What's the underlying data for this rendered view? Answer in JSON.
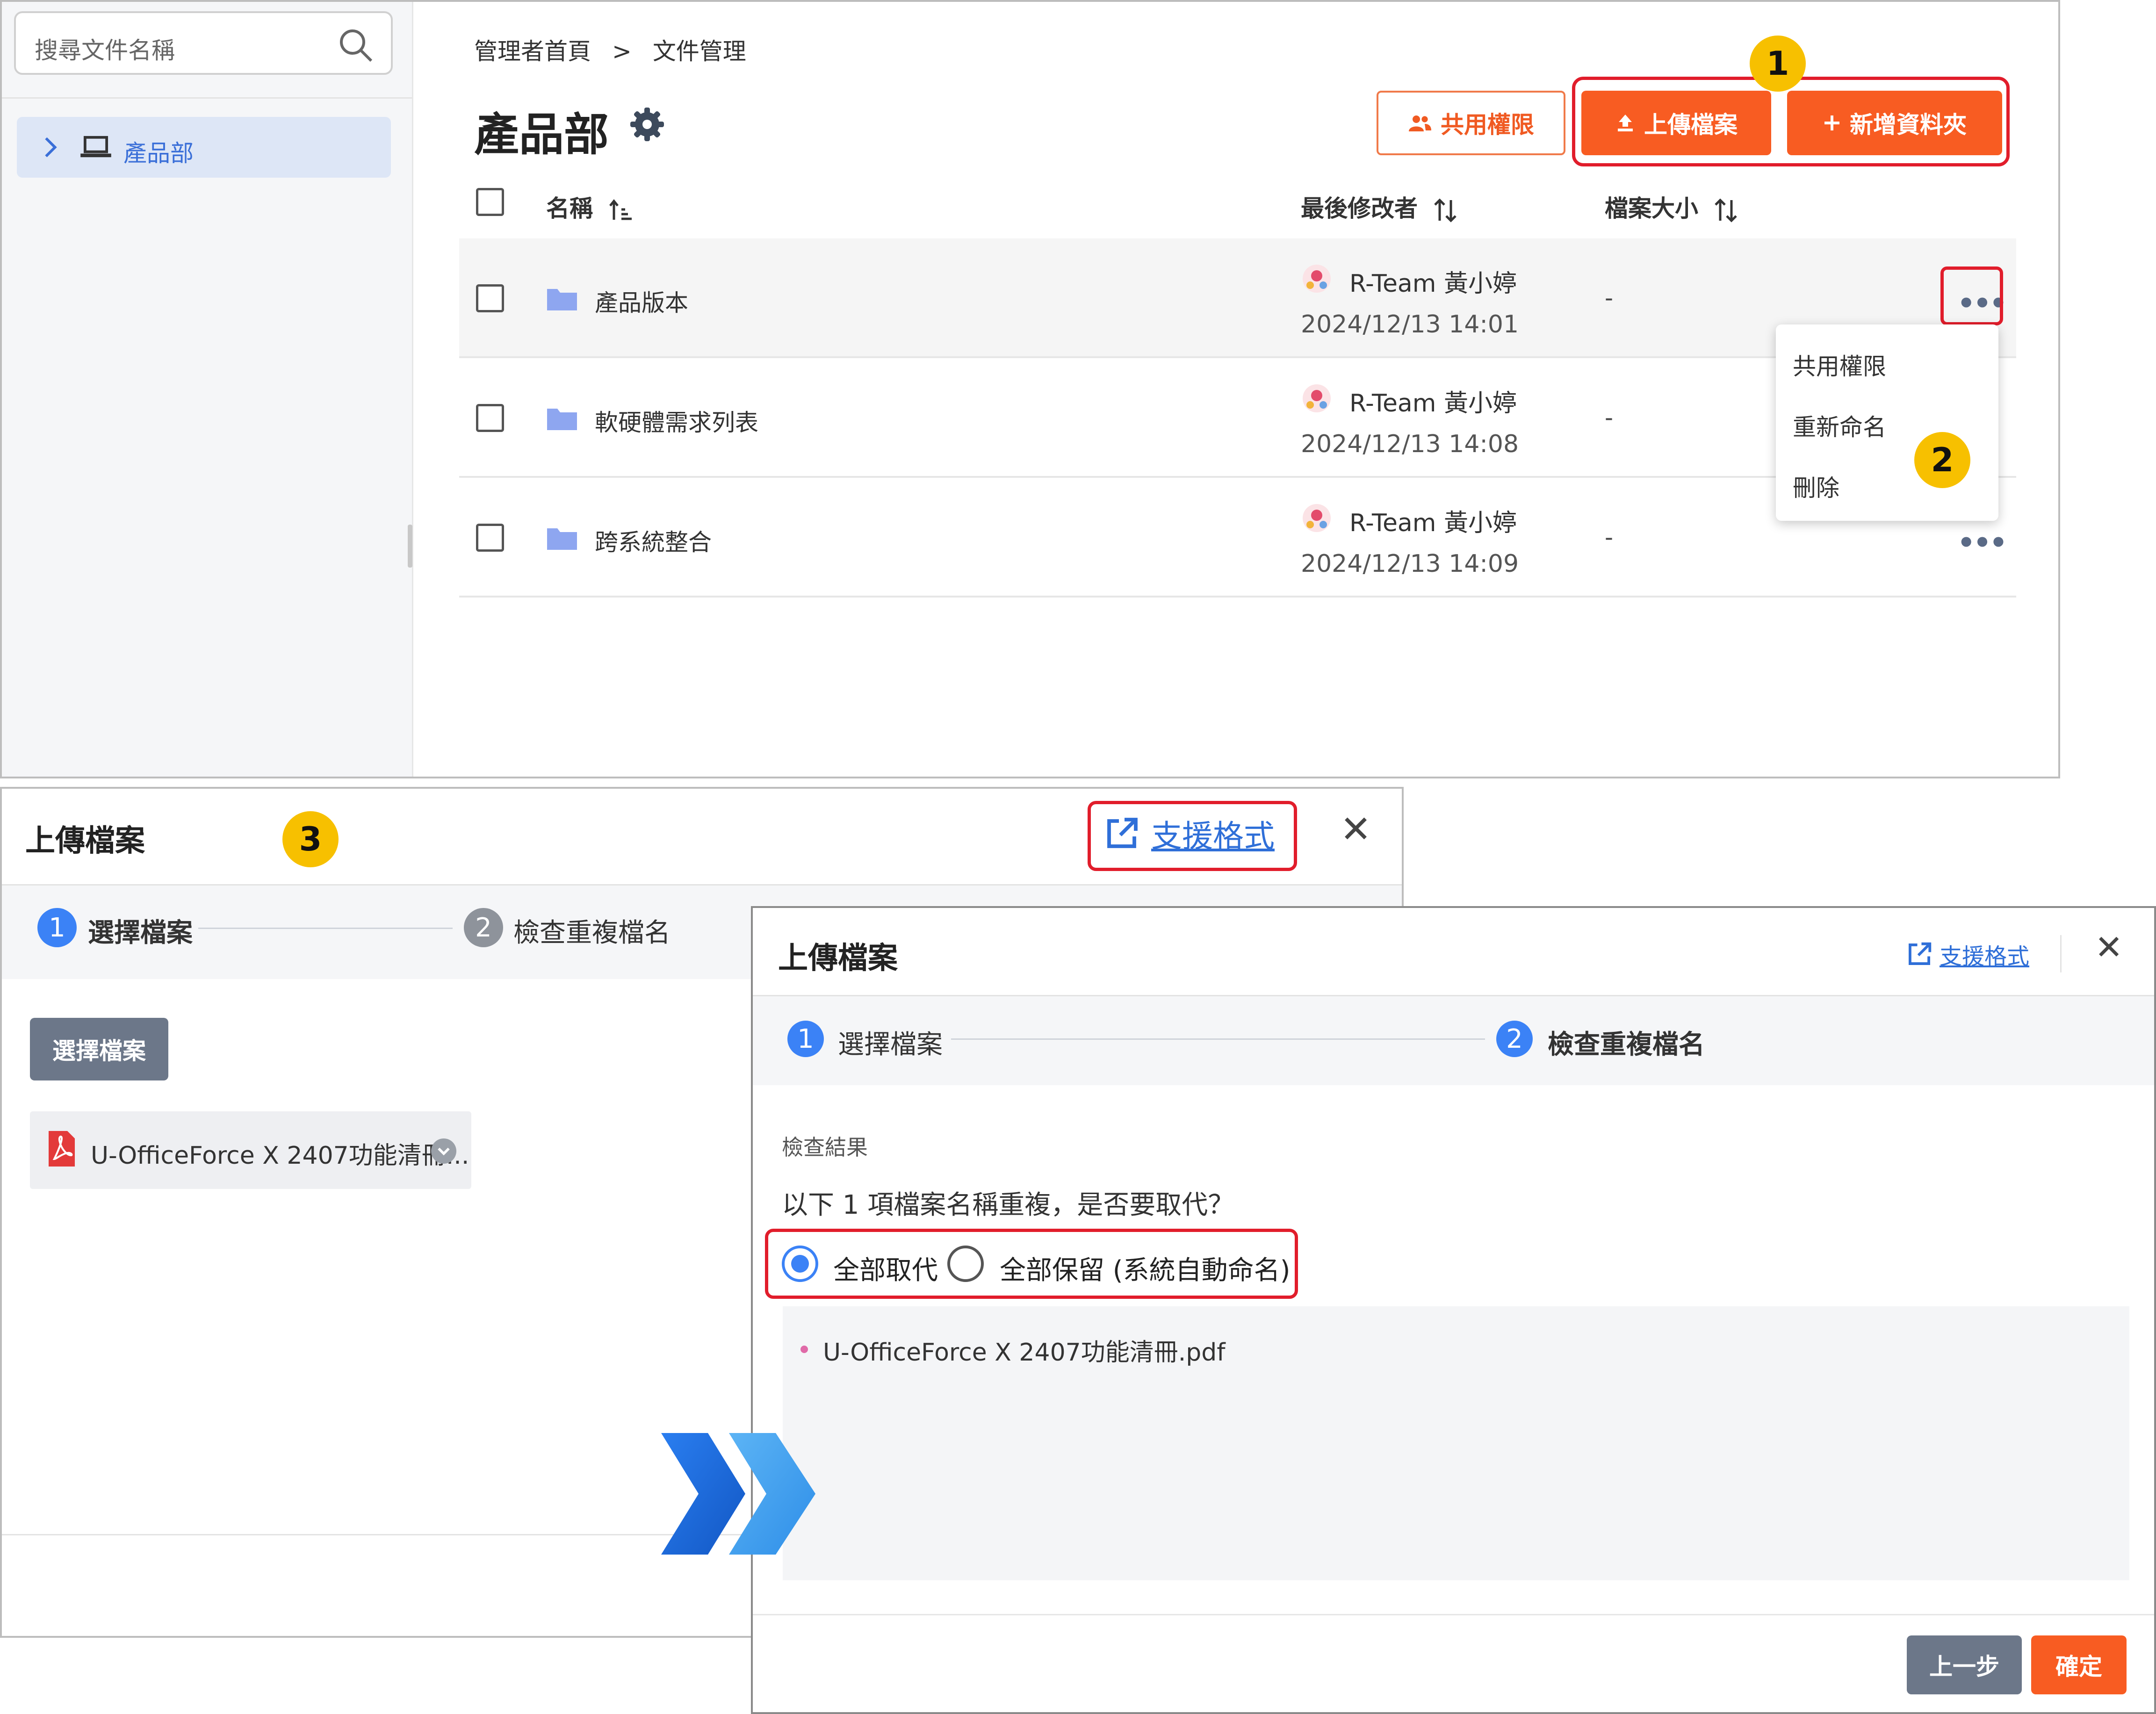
{
  "sidebar": {
    "search_placeholder": "搜尋文件名稱",
    "tree_item_label": "產品部"
  },
  "breadcrumb": {
    "home": "管理者首頁",
    "separator": ">",
    "current": "文件管理"
  },
  "page": {
    "title": "產品部"
  },
  "toolbar": {
    "share_label": "共用權限",
    "upload_label": "上傳檔案",
    "new_folder_label": "新增資料夾"
  },
  "table": {
    "headers": {
      "name": "名稱",
      "modifier": "最後修改者",
      "size": "檔案大小"
    },
    "rows": [
      {
        "name": "產品版本",
        "user": "R-Team 黃小婷",
        "date": "2024/12/13 14:01",
        "size": "-"
      },
      {
        "name": "軟硬體需求列表",
        "user": "R-Team 黃小婷",
        "date": "2024/12/13 14:08",
        "size": "-"
      },
      {
        "name": "跨系統整合",
        "user": "R-Team 黃小婷",
        "date": "2024/12/13 14:09",
        "size": "-"
      }
    ],
    "more_label": "•••"
  },
  "context_menu": {
    "items": [
      "共用權限",
      "重新命名",
      "刪除"
    ]
  },
  "badges": {
    "one": "1",
    "two": "2",
    "three": "3"
  },
  "dialog1": {
    "title": "上傳檔案",
    "support_link": "支援格式",
    "close": "✕",
    "steps": [
      {
        "num": "1",
        "label": "選擇檔案"
      },
      {
        "num": "2",
        "label": "檢查重複檔名"
      }
    ],
    "choose_button": "選擇檔案",
    "file_name": "U-OfficeForce X 2407功能清冊..."
  },
  "dialog2": {
    "title": "上傳檔案",
    "support_link": "支援格式",
    "close": "✕",
    "steps": [
      {
        "num": "1",
        "label": "選擇檔案"
      },
      {
        "num": "2",
        "label": "檢查重複檔名"
      }
    ],
    "result_label": "檢查結果",
    "question": "以下 1 項檔案名稱重複，是否要取代？",
    "options": {
      "replace_all": "全部取代",
      "keep_all": "全部保留 (系統自動命名)",
      "selected": "replace_all"
    },
    "duplicate_file": "U-OfficeForce X 2407功能清冊.pdf",
    "prev_button": "上一步",
    "ok_button": "確定"
  },
  "colors": {
    "accent": "#f85c22",
    "highlight": "#e11d2b",
    "badge": "#f7c000",
    "link": "#2f6fd8",
    "step_active": "#3b82f6",
    "step_inactive": "#8e939b"
  },
  "icons": [
    "search-icon",
    "chevron-right-icon",
    "laptop-icon",
    "gear-icon",
    "users-icon",
    "upload-icon",
    "plus-icon",
    "sort-icon",
    "folder-icon",
    "avatar-icon",
    "more-icon",
    "external-link-icon",
    "close-icon",
    "pdf-icon",
    "remove-icon",
    "double-chevron-icon"
  ]
}
